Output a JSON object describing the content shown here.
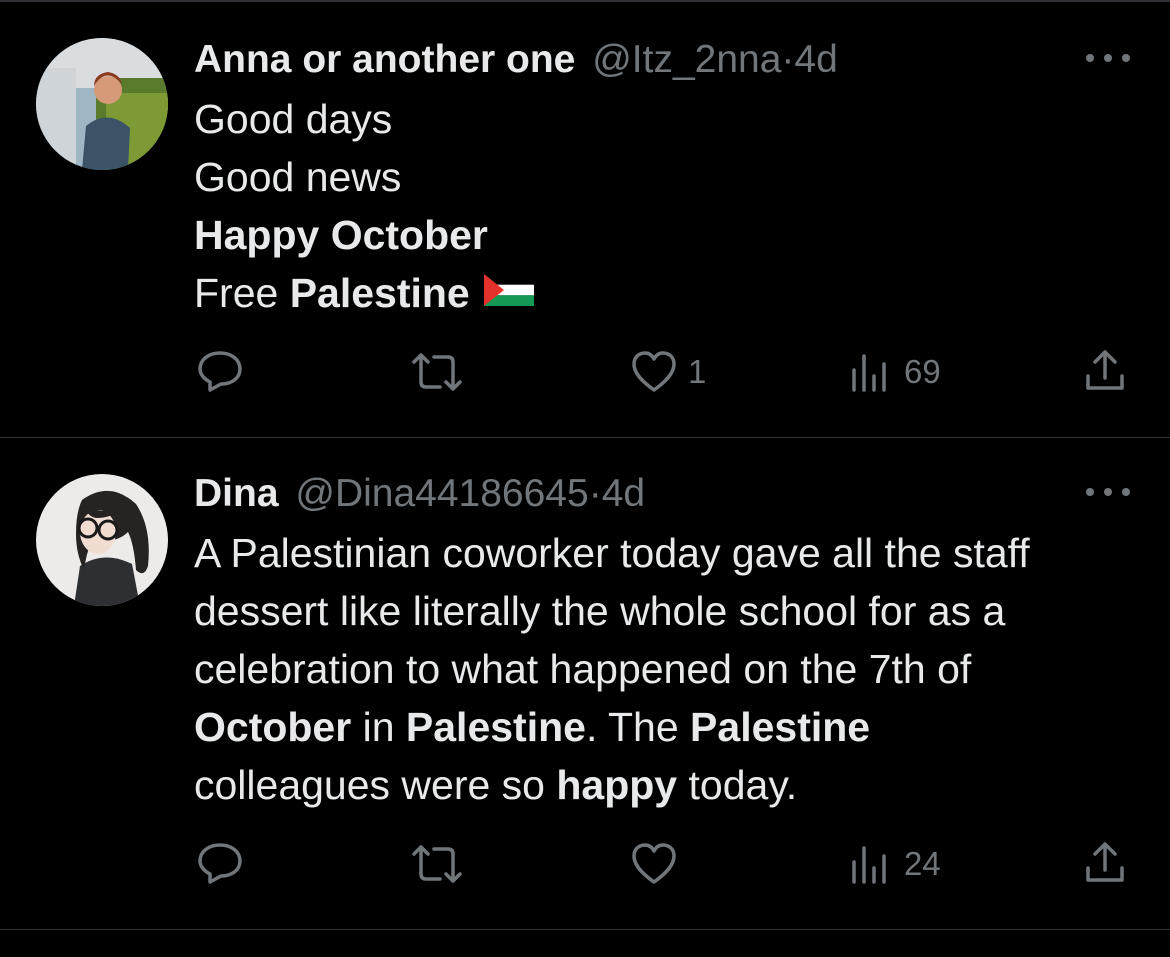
{
  "tweets": [
    {
      "author_name": "Anna or another one",
      "handle": "@Itz_2nna",
      "separator": "·",
      "time": "4d",
      "lines": {
        "l1": "Good days",
        "l2": "Good news",
        "l3_bold": "Happy October",
        "l4_prefix": "Free ",
        "l4_bold": "Palestine"
      },
      "flag_emoji": "palestine-flag",
      "actions": {
        "reply": "",
        "retweet": "",
        "like": "1",
        "views": "69"
      }
    },
    {
      "author_name": "Dina",
      "handle": "@Dina44186645",
      "separator": "·",
      "time": "4d",
      "lines": {
        "l1": "A Palestinian coworker today gave all the staff",
        "l2": "dessert like literally the whole school for as a",
        "l3": "celebration to what happened on the 7th of",
        "l4_b1": "October",
        "l4_t1": " in ",
        "l4_b2": "Palestine",
        "l4_t2": ". The ",
        "l4_b3": "Palestine",
        "l5_t1": "colleagues were so ",
        "l5_b1": "happy",
        "l5_t2": " today."
      },
      "actions": {
        "reply": "",
        "retweet": "",
        "like": "",
        "views": "24"
      }
    }
  ],
  "icons": {
    "reply": "reply-icon",
    "retweet": "retweet-icon",
    "like": "heart-icon",
    "views": "views-icon",
    "share": "share-icon",
    "more": "more-icon"
  },
  "colors": {
    "background": "#000000",
    "text": "#e7e9ea",
    "muted": "#71767b",
    "divider": "#2f3336"
  }
}
